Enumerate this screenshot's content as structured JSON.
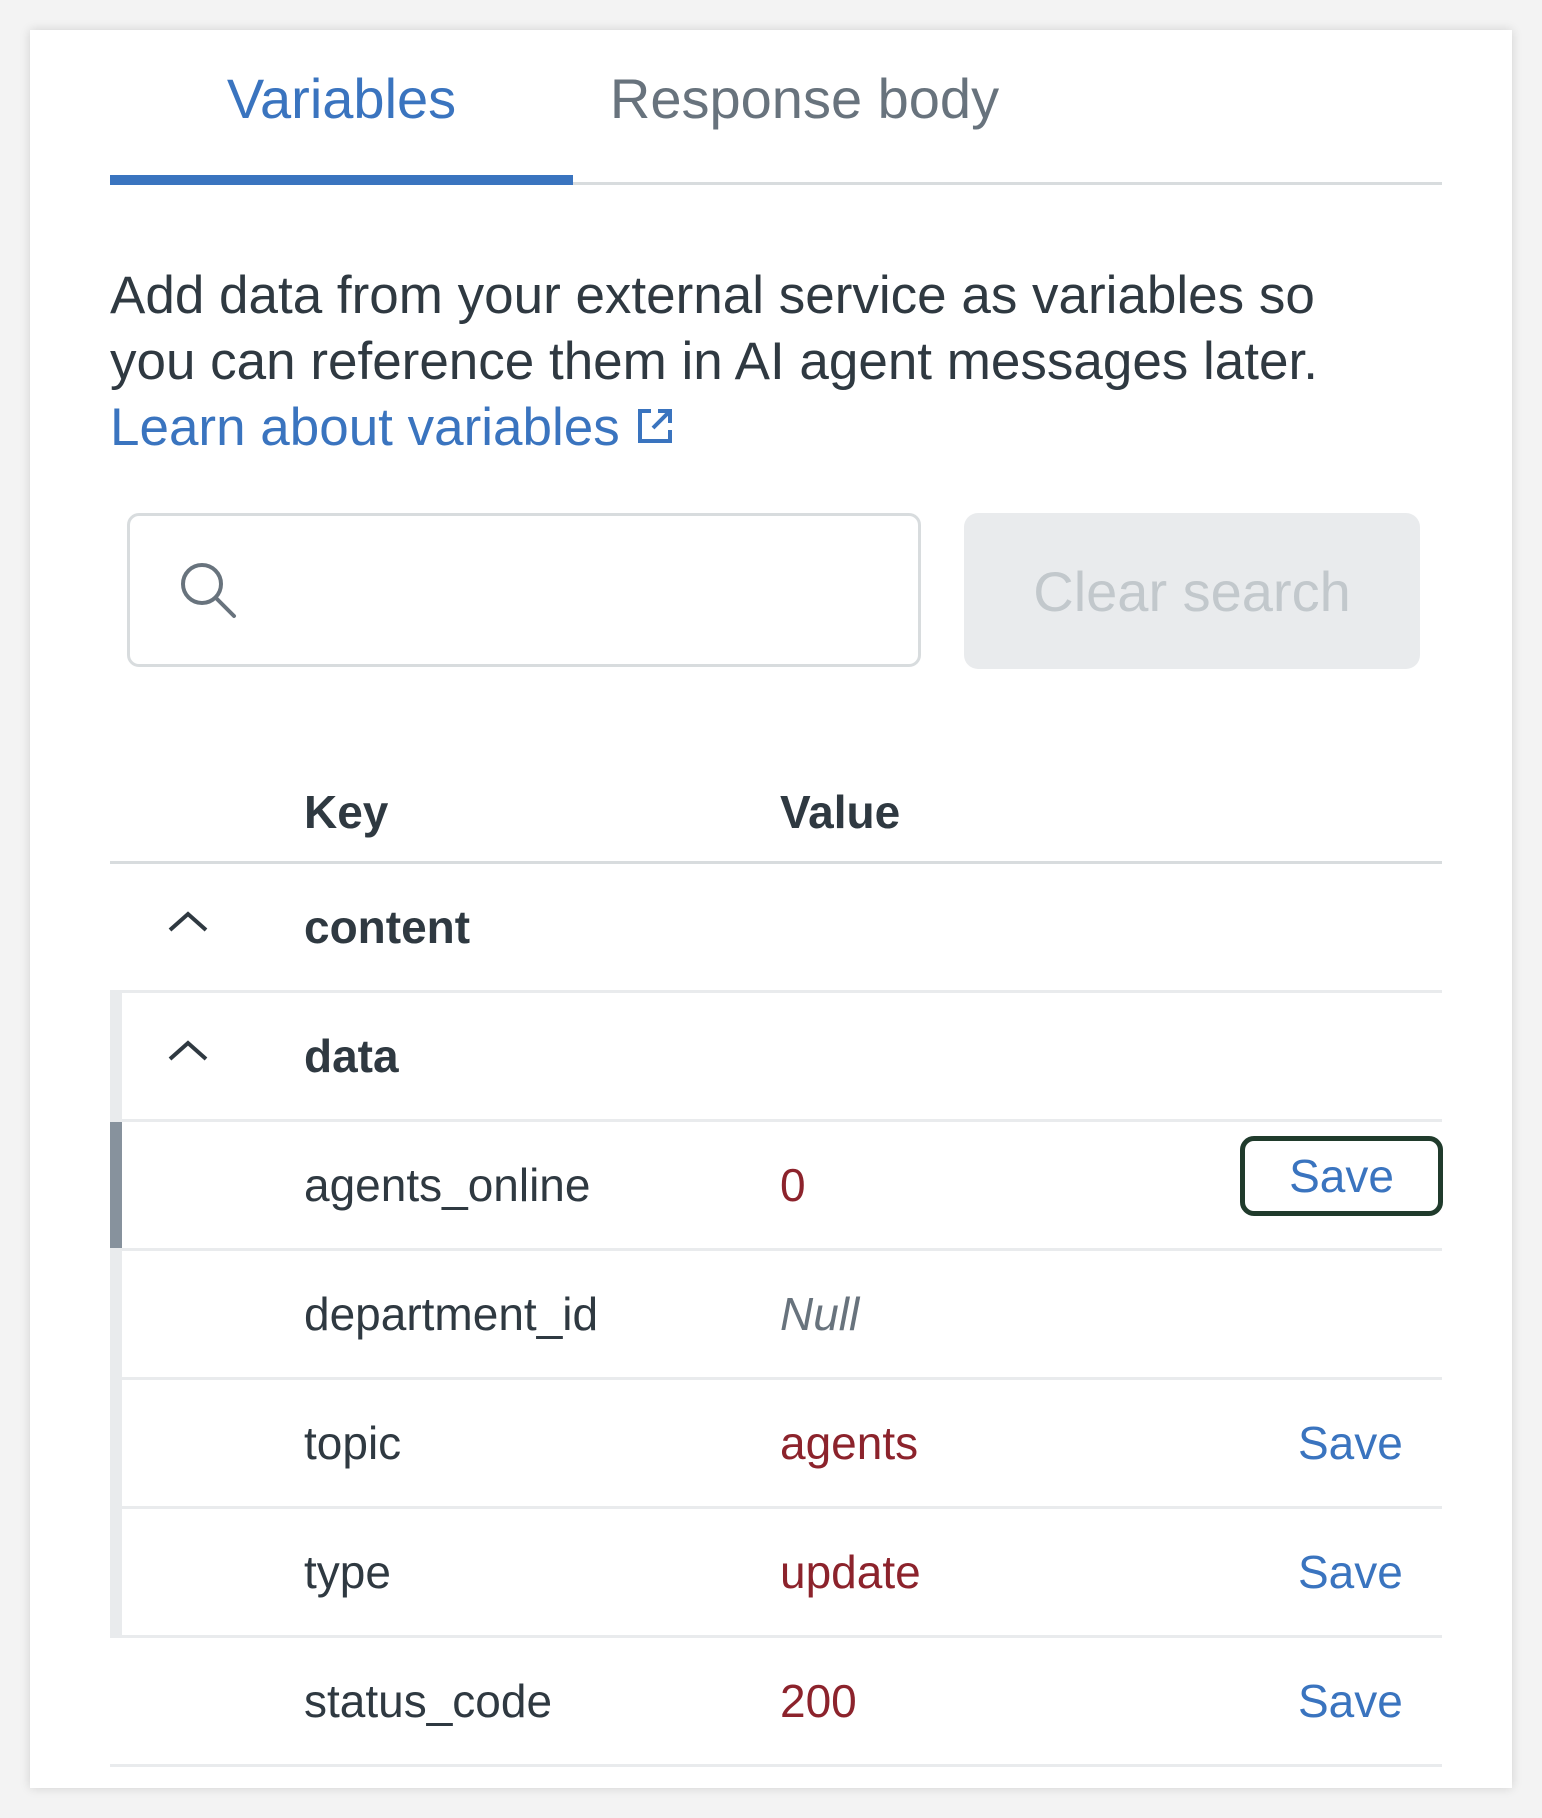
{
  "tabs": [
    {
      "label": "Variables",
      "active": true
    },
    {
      "label": "Response body",
      "active": false
    }
  ],
  "description": {
    "text_line1": "Add data from your external service as variables so",
    "text_line2": "you can reference them in AI agent messages later.",
    "link_label": "Learn about variables"
  },
  "search": {
    "value": "",
    "placeholder": "",
    "clear_label": "Clear search"
  },
  "table": {
    "headers": {
      "key": "Key",
      "value": "Value"
    },
    "rows": [
      {
        "key": "content",
        "value": "",
        "group": true,
        "expanded": true
      },
      {
        "key": "data",
        "value": "",
        "group": true,
        "expanded": true
      },
      {
        "key": "agents_online",
        "value": "0",
        "action": "Save",
        "focused": true
      },
      {
        "key": "department_id",
        "value": "Null"
      },
      {
        "key": "topic",
        "value": "agents",
        "action": "Save"
      },
      {
        "key": "type",
        "value": "update",
        "action": "Save"
      },
      {
        "key": "status_code",
        "value": "200",
        "action": "Save"
      }
    ]
  },
  "colors": {
    "accent": "#3a74bf",
    "value_text": "#8c232c",
    "focus_ring": "#203b2c"
  },
  "icons": [
    "search-icon",
    "external-link-icon",
    "chevron-up-icon"
  ]
}
